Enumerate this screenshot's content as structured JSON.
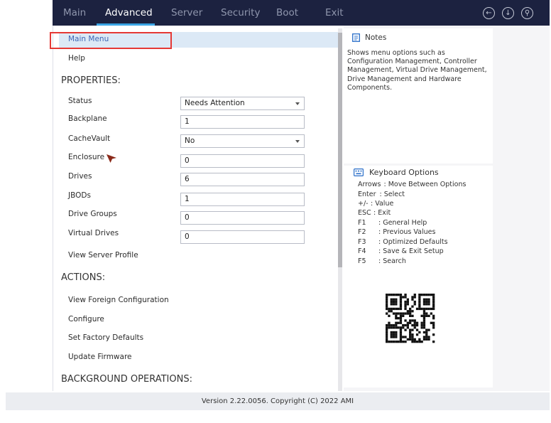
{
  "tabs": [
    {
      "label": "Main",
      "active": false
    },
    {
      "label": "Advanced",
      "active": true
    },
    {
      "label": "Server",
      "active": false
    },
    {
      "label": "Security",
      "active": false
    },
    {
      "label": "Boot",
      "active": false
    },
    {
      "label": "Exit",
      "active": false
    }
  ],
  "top_icons": [
    "back-arrow-icon",
    "download-icon",
    "search-icon"
  ],
  "menu": {
    "main_menu": "Main Menu",
    "help": "Help",
    "properties_title": "PROPERTIES:",
    "properties": [
      {
        "label": "Status",
        "value": "Needs Attention",
        "type": "select"
      },
      {
        "label": "Backplane",
        "value": "1",
        "type": "text"
      },
      {
        "label": "CacheVault",
        "value": "No",
        "type": "select"
      },
      {
        "label": "Enclosure",
        "value": "0",
        "type": "text"
      },
      {
        "label": "Drives",
        "value": "6",
        "type": "text"
      },
      {
        "label": "JBODs",
        "value": "1",
        "type": "text"
      },
      {
        "label": "Drive Groups",
        "value": "0",
        "type": "text"
      },
      {
        "label": "Virtual Drives",
        "value": "0",
        "type": "text"
      }
    ],
    "view_server_profile": "View Server Profile",
    "actions_title": "ACTIONS:",
    "actions": [
      "View Foreign Configuration",
      "Configure",
      "Set Factory Defaults",
      "Update Firmware"
    ],
    "background_title": "BACKGROUND OPERATIONS:"
  },
  "notes": {
    "title": "Notes",
    "text": "Shows menu options such as Configuration Management, Controller Management, Virtual Drive Management, Drive Management and Hardware Components."
  },
  "keyboard": {
    "title": "Keyboard Options",
    "options": [
      {
        "key": "Arrows",
        "desc": ": Move Between Options"
      },
      {
        "key": "Enter",
        "desc": ": Select"
      },
      {
        "key": "+/-",
        "desc": ": Value"
      },
      {
        "key": "ESC",
        "desc": ": Exit"
      },
      {
        "key": "F1",
        "desc": ": General Help"
      },
      {
        "key": "F2",
        "desc": ": Previous Values"
      },
      {
        "key": "F3",
        "desc": ": Optimized Defaults"
      },
      {
        "key": "F4",
        "desc": ": Save & Exit Setup"
      },
      {
        "key": "F5",
        "desc": ": Search"
      }
    ]
  },
  "footer": "Version 2.22.0056. Copyright (C) 2022 AMI",
  "colors": {
    "topbar": "#1c2240",
    "accent": "#3aa5e5",
    "highlight": "#dce9f6",
    "selection_border": "#e53935",
    "cursor": "#8b2a1a"
  }
}
